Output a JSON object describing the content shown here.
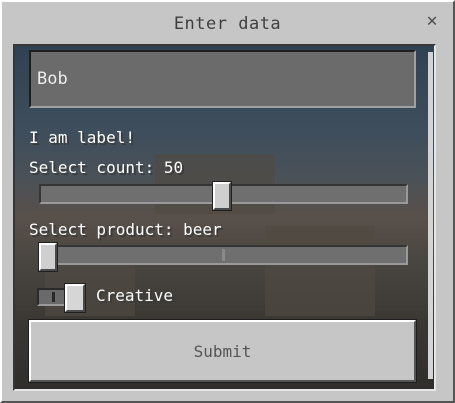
{
  "dialog": {
    "title": "Enter data",
    "close_icon": "close-icon"
  },
  "form": {
    "text_input": {
      "value": "Bob",
      "placeholder": ""
    },
    "label_text": "I am label!",
    "count_slider": {
      "label": "Select count: 50",
      "value": 50,
      "position_fraction": 0.5
    },
    "product_slider": {
      "label": "Select product: beer",
      "value": "beer",
      "position_fraction": 0.0
    },
    "creative_toggle": {
      "label": "Creative",
      "on": true
    },
    "submit_label": "Submit"
  },
  "colors": {
    "window_bg": "#c6c6c6",
    "panel_bg": "#4a4f55",
    "label_text": "#ffffff",
    "button_text": "#555555"
  }
}
